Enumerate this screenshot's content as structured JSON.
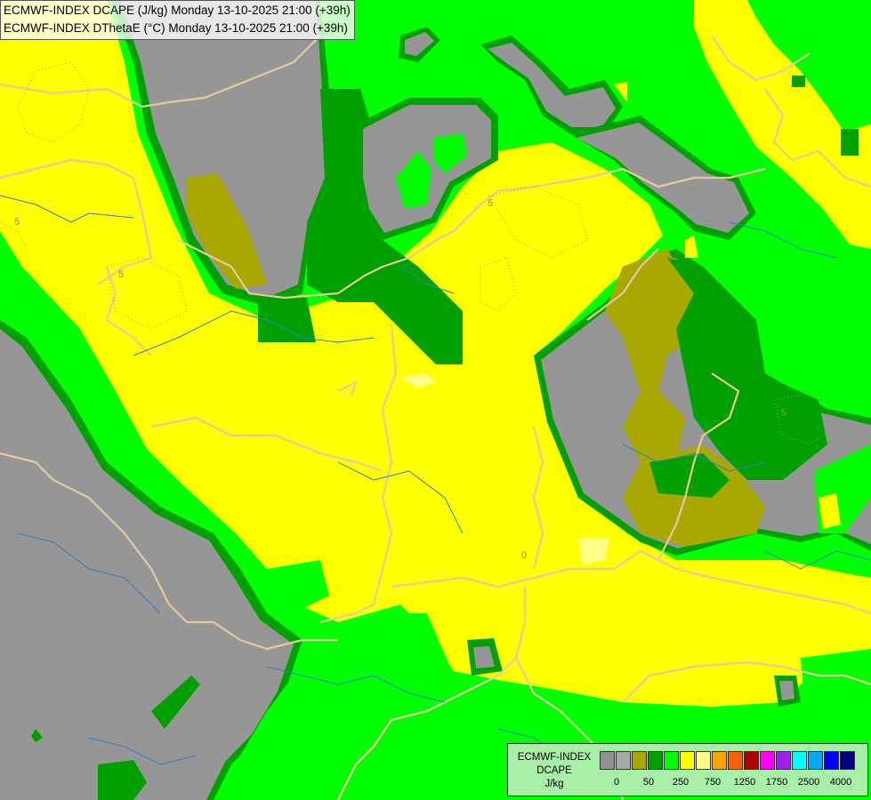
{
  "header": {
    "line1": "ECMWF-INDEX DCAPE (J/kg) Monday 13-10-2025 21:00 (+39h)",
    "line2": "ECMWF-INDEX DThetaE (°C) Monday 13-10-2025 21:00 (+39h)"
  },
  "legend": {
    "title_line1": "ECMWF-INDEX",
    "title_line2": "DCAPE",
    "title_line3": "J/kg",
    "swatches": [
      "#909090",
      "#a8a8a8",
      "#a8a800",
      "#00a000",
      "#00ff00",
      "#ffff00",
      "#ffff88",
      "#ffa500",
      "#ff6000",
      "#b00000",
      "#ff00ff",
      "#a020f0",
      "#00ffff",
      "#00a8ff",
      "#0000ff",
      "#000080"
    ],
    "tick_labels": [
      "0",
      "50",
      "250",
      "750",
      "1250",
      "1750",
      "2500",
      "4000"
    ]
  },
  "map_labels": {
    "contour_5a": "5",
    "contour_5b": "5",
    "contour_5c": "5",
    "contour_5d": "5",
    "contour_0": "0"
  },
  "colors": {
    "gray": "#969696",
    "olive": "#a8a800",
    "dark_green": "#00a000",
    "green": "#00ff00",
    "yellow": "#ffff00",
    "light_yellow": "#ffff88",
    "border": "#e8c8a0",
    "river": "#3080c0"
  }
}
